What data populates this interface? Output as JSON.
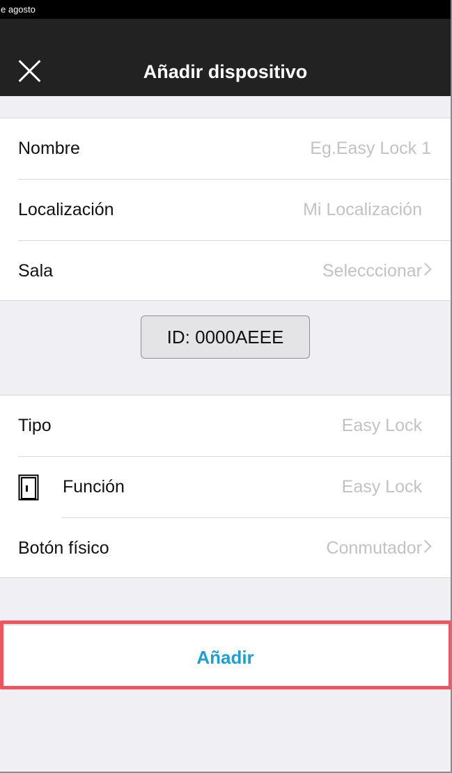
{
  "status_bar": {
    "text": "e agosto"
  },
  "header": {
    "title": "Añadir dispositivo",
    "close_icon": "close-icon"
  },
  "section1": {
    "rows": [
      {
        "label": "Nombre",
        "placeholder": "Eg.Easy Lock 1"
      },
      {
        "label": "Localización",
        "value": "Mi  Localización"
      },
      {
        "label": "Sala",
        "value": "Selecccionar"
      }
    ]
  },
  "id_button": {
    "label": "ID: 0000AEEE"
  },
  "section2": {
    "rows": [
      {
        "label": "Tipo",
        "value": "Easy Lock"
      },
      {
        "label": "Función",
        "value": "Easy Lock",
        "icon": "door-icon"
      },
      {
        "label": "Botón físico",
        "value": "Conmutador"
      }
    ]
  },
  "footer": {
    "add_label": "Añadir"
  },
  "colors": {
    "navbar": "#222222",
    "accent": "#1a9fd8",
    "highlight": "#f0545e",
    "background": "#efeff4"
  }
}
